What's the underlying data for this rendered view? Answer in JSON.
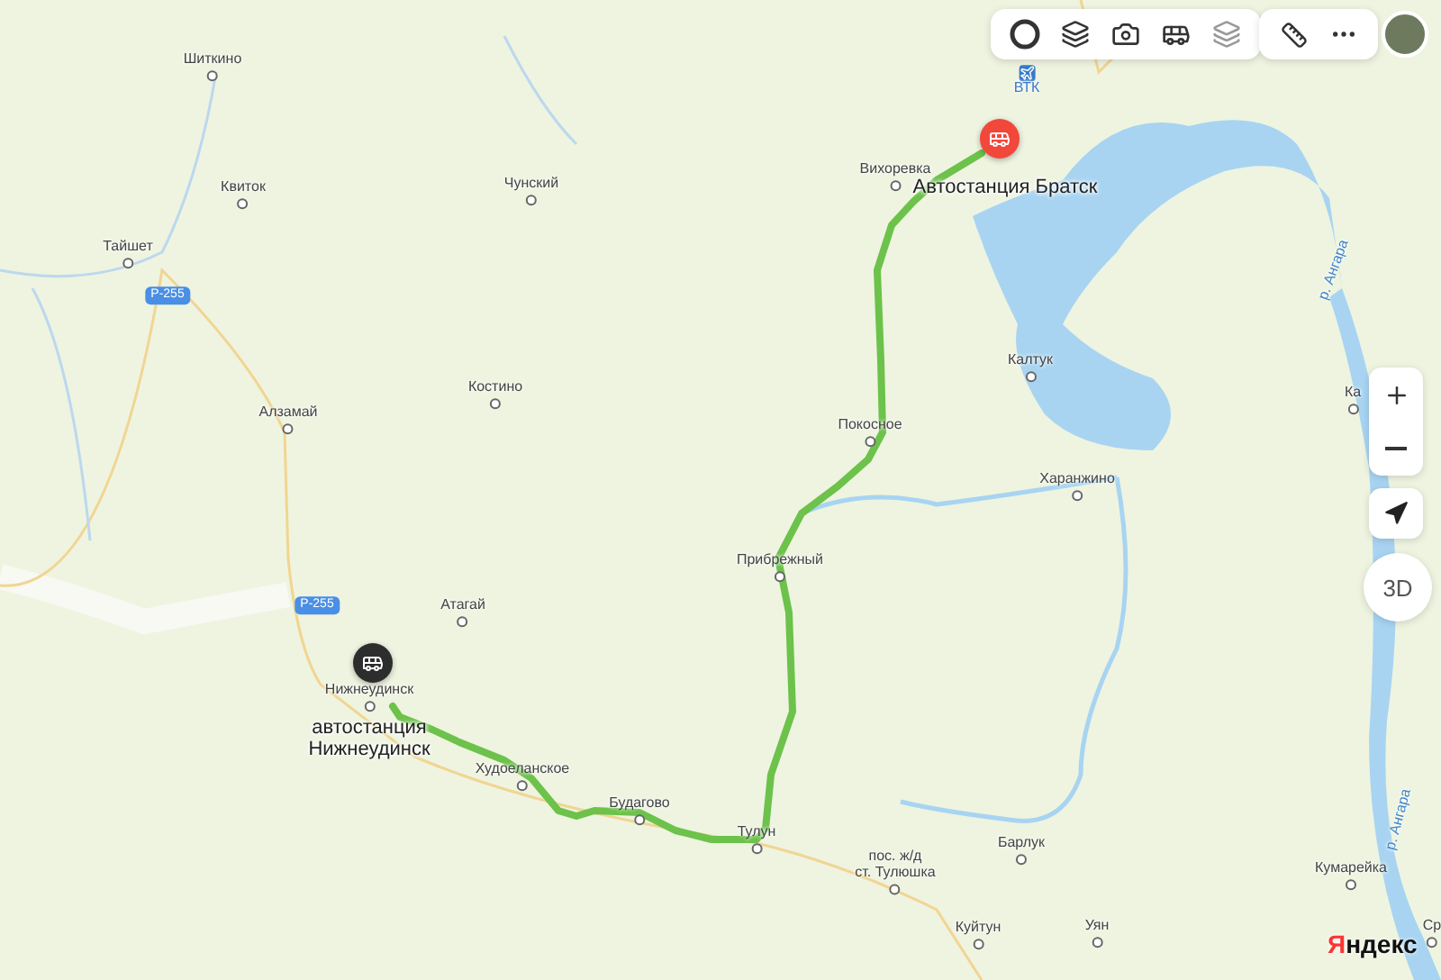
{
  "map": {
    "labels": [
      {
        "text": "Шиткино",
        "kind": "settlement"
      },
      {
        "text": "Квиток",
        "kind": "settlement"
      },
      {
        "text": "Тайшет",
        "kind": "settlement"
      },
      {
        "text": "Чунский",
        "kind": "settlement"
      },
      {
        "text": "Костино",
        "kind": "settlement"
      },
      {
        "text": "Алзамай",
        "kind": "settlement"
      },
      {
        "text": "Р-255",
        "kind": "road"
      },
      {
        "text": "Р-255",
        "kind": "road"
      },
      {
        "text": "Атагай",
        "kind": "settlement"
      },
      {
        "text": "Нижнеудинск",
        "kind": "settlement"
      },
      {
        "text": "Худоеланское",
        "kind": "settlement"
      },
      {
        "text": "Будагово",
        "kind": "settlement"
      },
      {
        "text": "Тулун",
        "kind": "settlement"
      },
      {
        "text": "пос. ж/д\nст. Тулюшка",
        "kind": "settlement"
      },
      {
        "text": "Куйтун",
        "kind": "settlement"
      },
      {
        "text": "Барлук",
        "kind": "settlement"
      },
      {
        "text": "Уян",
        "kind": "settlement"
      },
      {
        "text": "Кумарейка",
        "kind": "settlement"
      },
      {
        "text": "Ср",
        "kind": "settlement"
      },
      {
        "text": "Вихоревка",
        "kind": "settlement"
      },
      {
        "text": "Калтук",
        "kind": "settlement"
      },
      {
        "text": "Покосное",
        "kind": "settlement"
      },
      {
        "text": "Прибрежный",
        "kind": "settlement"
      },
      {
        "text": "Харанжино",
        "kind": "settlement"
      },
      {
        "text": "Ка",
        "kind": "settlement"
      },
      {
        "text": "ВТК",
        "kind": "airport"
      },
      {
        "text": "р. Ангара",
        "kind": "river"
      },
      {
        "text": "р. Ангара",
        "kind": "river"
      }
    ],
    "markers": [
      {
        "label": "автостанция\nНижнеудинск",
        "color": "#2d2d2d"
      },
      {
        "label": "Автостанция Братск",
        "color": "#f2473b"
      }
    ]
  },
  "compass": {
    "label": "3D"
  },
  "logo": {
    "first": "Я",
    "rest": "ндекс"
  }
}
